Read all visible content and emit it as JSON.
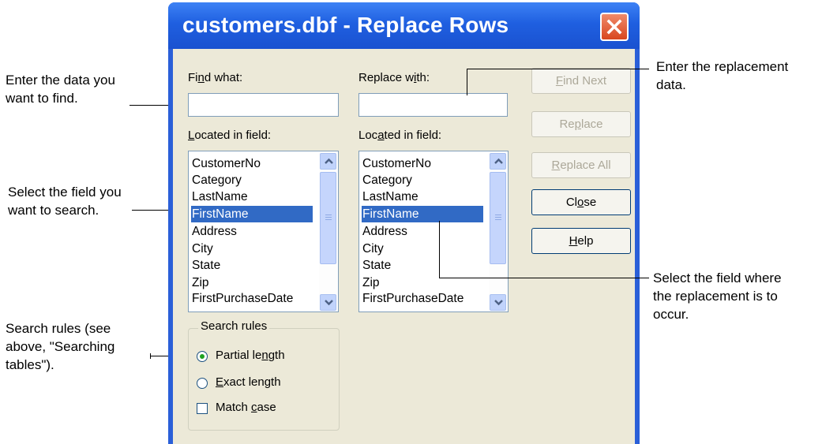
{
  "window": {
    "title": "customers.dbf - Replace Rows"
  },
  "find": {
    "label_pre": "Fi",
    "label_u": "n",
    "label_post": "d what:",
    "value": ""
  },
  "replace": {
    "label_pre": "Replace w",
    "label_u": "i",
    "label_post": "th:",
    "value": ""
  },
  "find_field": {
    "label_pre": "",
    "label_u": "L",
    "label_post": "ocated in field:",
    "items": [
      "CustomerNo",
      "Category",
      "LastName",
      "FirstName",
      "Address",
      "City",
      "State",
      "Zip",
      "FirstPurchaseDate"
    ],
    "selected": "FirstName"
  },
  "replace_field": {
    "label_pre": "Loc",
    "label_u": "a",
    "label_post": "ted in field:",
    "items": [
      "CustomerNo",
      "Category",
      "LastName",
      "FirstName",
      "Address",
      "City",
      "State",
      "Zip",
      "FirstPurchaseDate"
    ],
    "selected": "FirstName"
  },
  "buttons": {
    "find_next": {
      "pre": "",
      "u": "F",
      "post": "ind Next",
      "enabled": false
    },
    "replace": {
      "pre": "Re",
      "u": "p",
      "post": "lace",
      "enabled": false
    },
    "replace_all": {
      "pre": "",
      "u": "R",
      "post": "eplace All",
      "enabled": false
    },
    "close": {
      "pre": "Cl",
      "u": "o",
      "post": "se",
      "enabled": true
    },
    "help": {
      "pre": "",
      "u": "H",
      "post": "elp",
      "enabled": true
    }
  },
  "search_rules": {
    "title": "Search rules",
    "partial": {
      "pre": "Partial le",
      "u": "n",
      "post": "gth",
      "checked": true
    },
    "exact": {
      "pre": "",
      "u": "E",
      "post": "xact length",
      "checked": false
    },
    "match_case": {
      "pre": "Match ",
      "u": "c",
      "post": "ase",
      "checked": false
    }
  },
  "annotations": {
    "find": "Enter the data you\nwant to find.",
    "replace": "Enter the replacement\ndata.",
    "field": "Select the field you\nwant to search.",
    "replace_field": "Select the field where\nthe replacement is to\noccur.",
    "rules": "Search rules (see\nabove, \"Searching\ntables\")."
  },
  "colors": {
    "title_bar": "#1f5fe0",
    "selection": "#316ac5",
    "dialog_bg": "#ece9d8"
  },
  "icons": {
    "close": "close-icon",
    "scroll_up": "chevron-up-icon",
    "scroll_down": "chevron-down-icon"
  }
}
